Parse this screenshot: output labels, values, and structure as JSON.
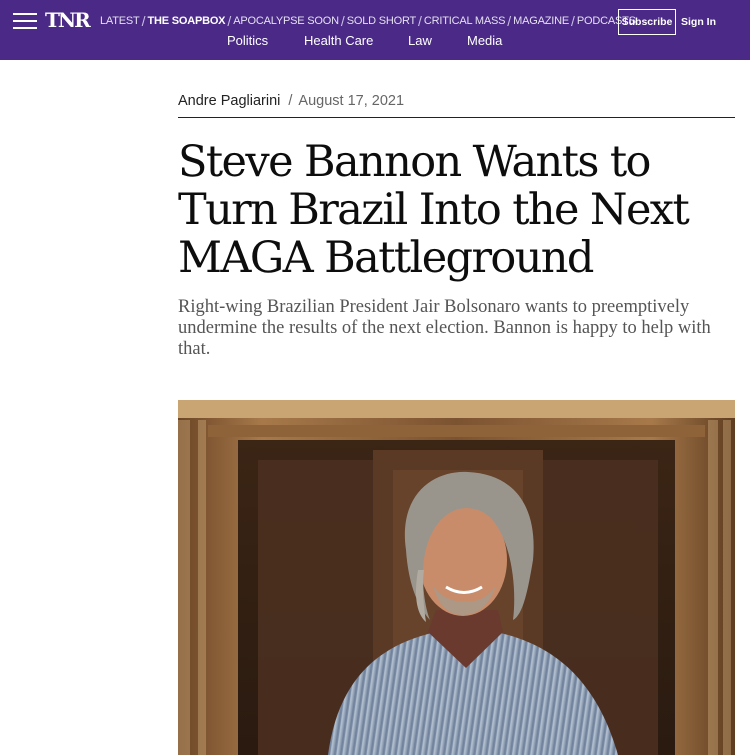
{
  "header": {
    "logo": "TNR",
    "menu_icon": "hamburger-menu-icon",
    "sections": [
      {
        "label": "LATEST",
        "active": false
      },
      {
        "label": "THE SOAPBOX",
        "active": true
      },
      {
        "label": "APOCALYPSE SOON",
        "active": false
      },
      {
        "label": "SOLD SHORT",
        "active": false
      },
      {
        "label": "CRITICAL MASS",
        "active": false
      },
      {
        "label": "MAGAZINE",
        "active": false
      },
      {
        "label": "PODCASTS",
        "active": false
      }
    ],
    "subscribe_label": "Subscribe",
    "signin_label": "Sign In",
    "topics": [
      "Politics",
      "Health Care",
      "Law",
      "Media"
    ],
    "background_color": "#4a2a86"
  },
  "article": {
    "author": "Andre Pagliarini",
    "separator": "/",
    "date": "August 17, 2021",
    "headline": "Steve Bannon Wants to Turn Brazil Into the Next MAGA Battleground",
    "dek": "Right-wing Brazilian President Jair Bolsonaro wants to preemptively undermine the results of the next election. Bannon is happy to help with that."
  }
}
